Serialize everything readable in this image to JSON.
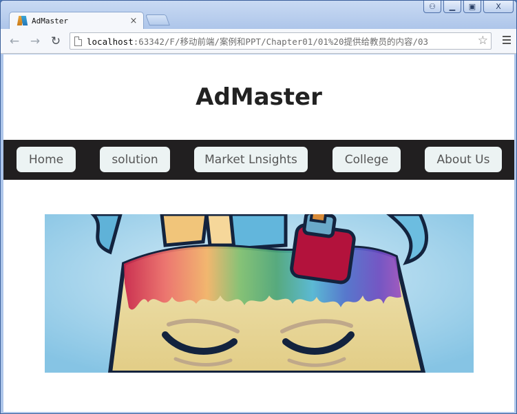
{
  "browser": {
    "tab_title": "AdMaster",
    "tab_close": "×",
    "url_host": "localhost",
    "url_rest": ":63342/F/移动前端/案例和PPT/Chapter01/01%20提供给教员的内容/03",
    "controls": {
      "user": "⚇",
      "minimize": "▁",
      "maximize": "▣",
      "close": "X"
    }
  },
  "page": {
    "title": "AdMaster",
    "nav": [
      "Home",
      "solution",
      "Market Lnsights",
      "College",
      "About Us"
    ]
  },
  "colors": {
    "navbar_bg": "#211f20",
    "nav_button_bg": "#ecf3f3",
    "nav_text": "#555555",
    "title_text": "#222222"
  }
}
